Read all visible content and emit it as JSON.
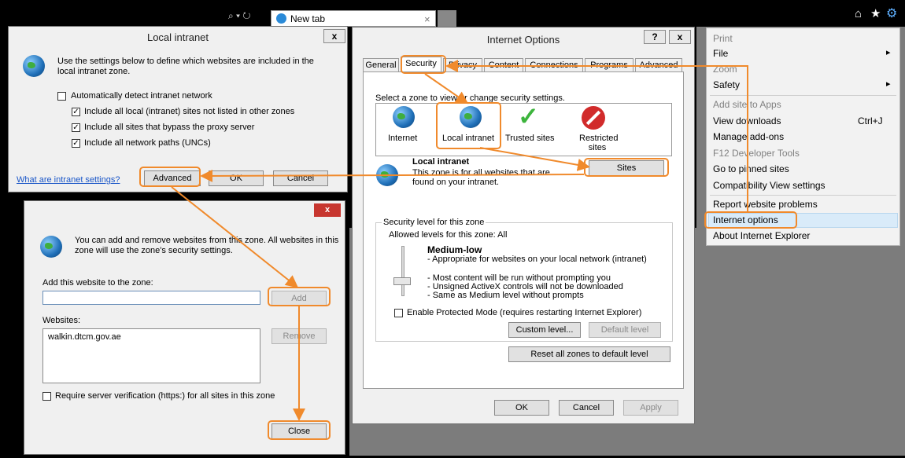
{
  "browser": {
    "tab_label": "New tab",
    "tab_close": "×",
    "search_glyph": "⌕ ▾ ↻"
  },
  "menu": {
    "items": [
      {
        "label": "Print",
        "disabled": true
      },
      {
        "label": "File",
        "arrow": "▸"
      },
      {
        "label": "Zoom",
        "disabled": true
      },
      {
        "label": "Safety",
        "arrow": "▸"
      },
      {
        "label": "Add site to Apps",
        "disabled": true
      },
      {
        "label": "View downloads",
        "shortcut": "Ctrl+J"
      },
      {
        "label": "Manage add-ons"
      },
      {
        "label": "F12 Developer Tools",
        "disabled": true
      },
      {
        "label": "Go to pinned sites"
      },
      {
        "label": "Compatibility View settings"
      },
      {
        "label": "Report website problems"
      },
      {
        "label": "Internet options",
        "highlighted": true
      },
      {
        "label": "About Internet Explorer"
      }
    ]
  },
  "local_intranet": {
    "title": "Local intranet",
    "close": "x",
    "description": "Use the settings below to define which websites are included in the local intranet zone.",
    "auto_detect": {
      "label": "Automatically detect intranet network",
      "checked": false
    },
    "options": [
      {
        "label": "Include all local (intranet) sites not listed in other zones",
        "checked": true
      },
      {
        "label": "Include all sites that bypass the proxy server",
        "checked": true
      },
      {
        "label": "Include all network paths (UNCs)",
        "checked": true
      }
    ],
    "link": "What are intranet settings?",
    "advanced": "Advanced",
    "ok": "OK",
    "cancel": "Cancel"
  },
  "sites_dialog": {
    "close": "x",
    "description": "You can add and remove websites from this zone. All websites in this zone will use the zone's security settings.",
    "add_label": "Add this website to the zone:",
    "add_value": "",
    "add_button": "Add",
    "websites_label": "Websites:",
    "websites": [
      "walkin.dtcm.gov.ae"
    ],
    "remove_button": "Remove",
    "require_https": {
      "label": "Require server verification (https:) for all sites in this zone",
      "checked": false
    },
    "close_button": "Close"
  },
  "internet_options": {
    "title": "Internet Options",
    "help": "?",
    "close": "x",
    "tabs": [
      "General",
      "Security",
      "Privacy",
      "Content",
      "Connections",
      "Programs",
      "Advanced"
    ],
    "zone_prompt": "Select a zone to view or change security settings.",
    "zones": [
      {
        "label": "Internet"
      },
      {
        "label": "Local intranet"
      },
      {
        "label": "Trusted sites"
      },
      {
        "label": "Restricted sites"
      }
    ],
    "zone_title": "Local intranet",
    "zone_desc": "This zone is for all websites that are found on your intranet.",
    "sites_button": "Sites",
    "security_group": "Security level for this zone",
    "allowed_levels": "Allowed levels for this zone: All",
    "level_name": "Medium-low",
    "level_bullets": [
      "- Appropriate for websites on your local network (intranet)",
      "- Most content will be run without prompting you",
      "- Unsigned ActiveX controls will not be downloaded",
      "- Same as Medium level without prompts"
    ],
    "protected_mode": {
      "label": "Enable Protected Mode (requires restarting Internet Explorer)",
      "checked": false
    },
    "custom_level": "Custom level...",
    "default_level": "Default level",
    "reset_all": "Reset all zones to default level",
    "ok": "OK",
    "cancel": "Cancel",
    "apply": "Apply"
  },
  "colors": {
    "highlight": "#f08a2c",
    "menu_highlight": "#d9ebf9"
  }
}
